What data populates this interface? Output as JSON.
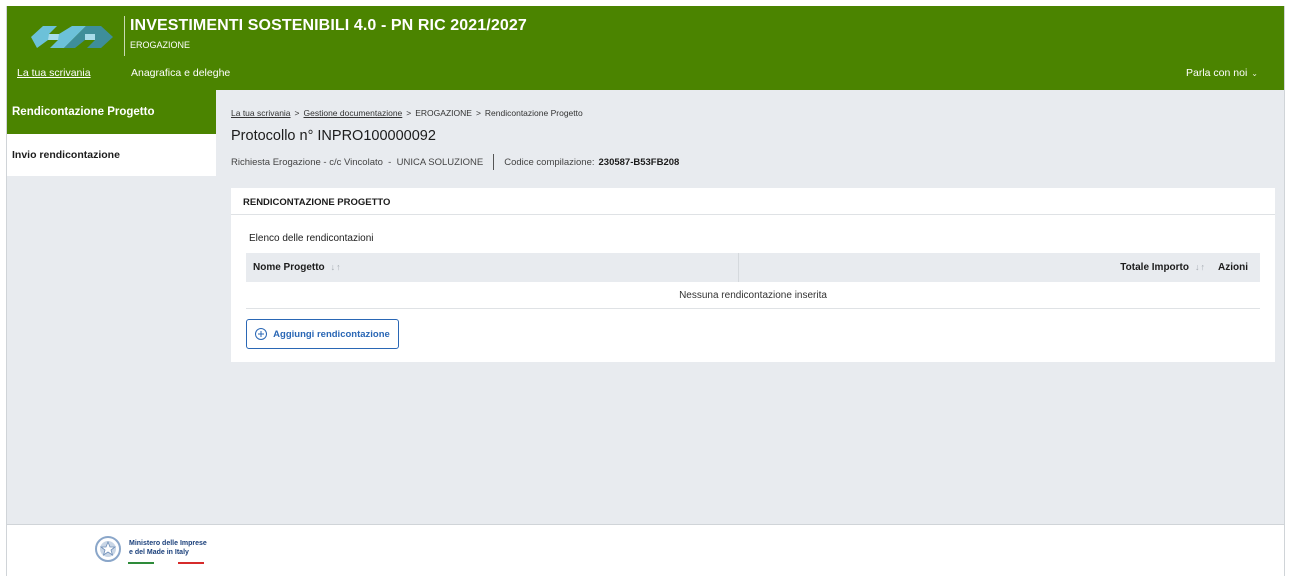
{
  "header": {
    "title": "INVESTIMENTI SOSTENIBILI 4.0 - PN RIC 2021/2027",
    "subtitle": "EROGAZIONE",
    "nav": [
      {
        "label": "La tua scrivania"
      },
      {
        "label": "Anagrafica e deleghe"
      }
    ],
    "chat_label": "Parla con noi",
    "brand_color": "#4b8400"
  },
  "sidebar": {
    "header": "Rendicontazione Progetto",
    "items": [
      {
        "label": "Invio rendicontazione"
      }
    ]
  },
  "breadcrumb": {
    "items": [
      "La tua scrivania",
      "Gestione documentazione",
      "EROGAZIONE",
      "Rendicontazione Progetto"
    ],
    "separator": ">"
  },
  "page": {
    "protocol": "Protocollo n° INPRO100000092",
    "request": "Richiesta Erogazione - c/c Vincolato  -  UNICA SOLUZIONE",
    "code_label": "Codice compilazione:",
    "code_value": "230587-B53FB208"
  },
  "card": {
    "title": "RENDICONTAZIONE PROGETTO",
    "list_title": "Elenco delle rendicontazioni",
    "columns": [
      "Nome Progetto",
      "Totale Importo",
      "Azioni"
    ],
    "empty_message": "Nessuna rendicontazione inserita",
    "add_button": "Aggiungi rendicontazione"
  },
  "footer": {
    "ministry_line1": "Ministero delle Imprese",
    "ministry_line2": "e del Made in Italy"
  }
}
